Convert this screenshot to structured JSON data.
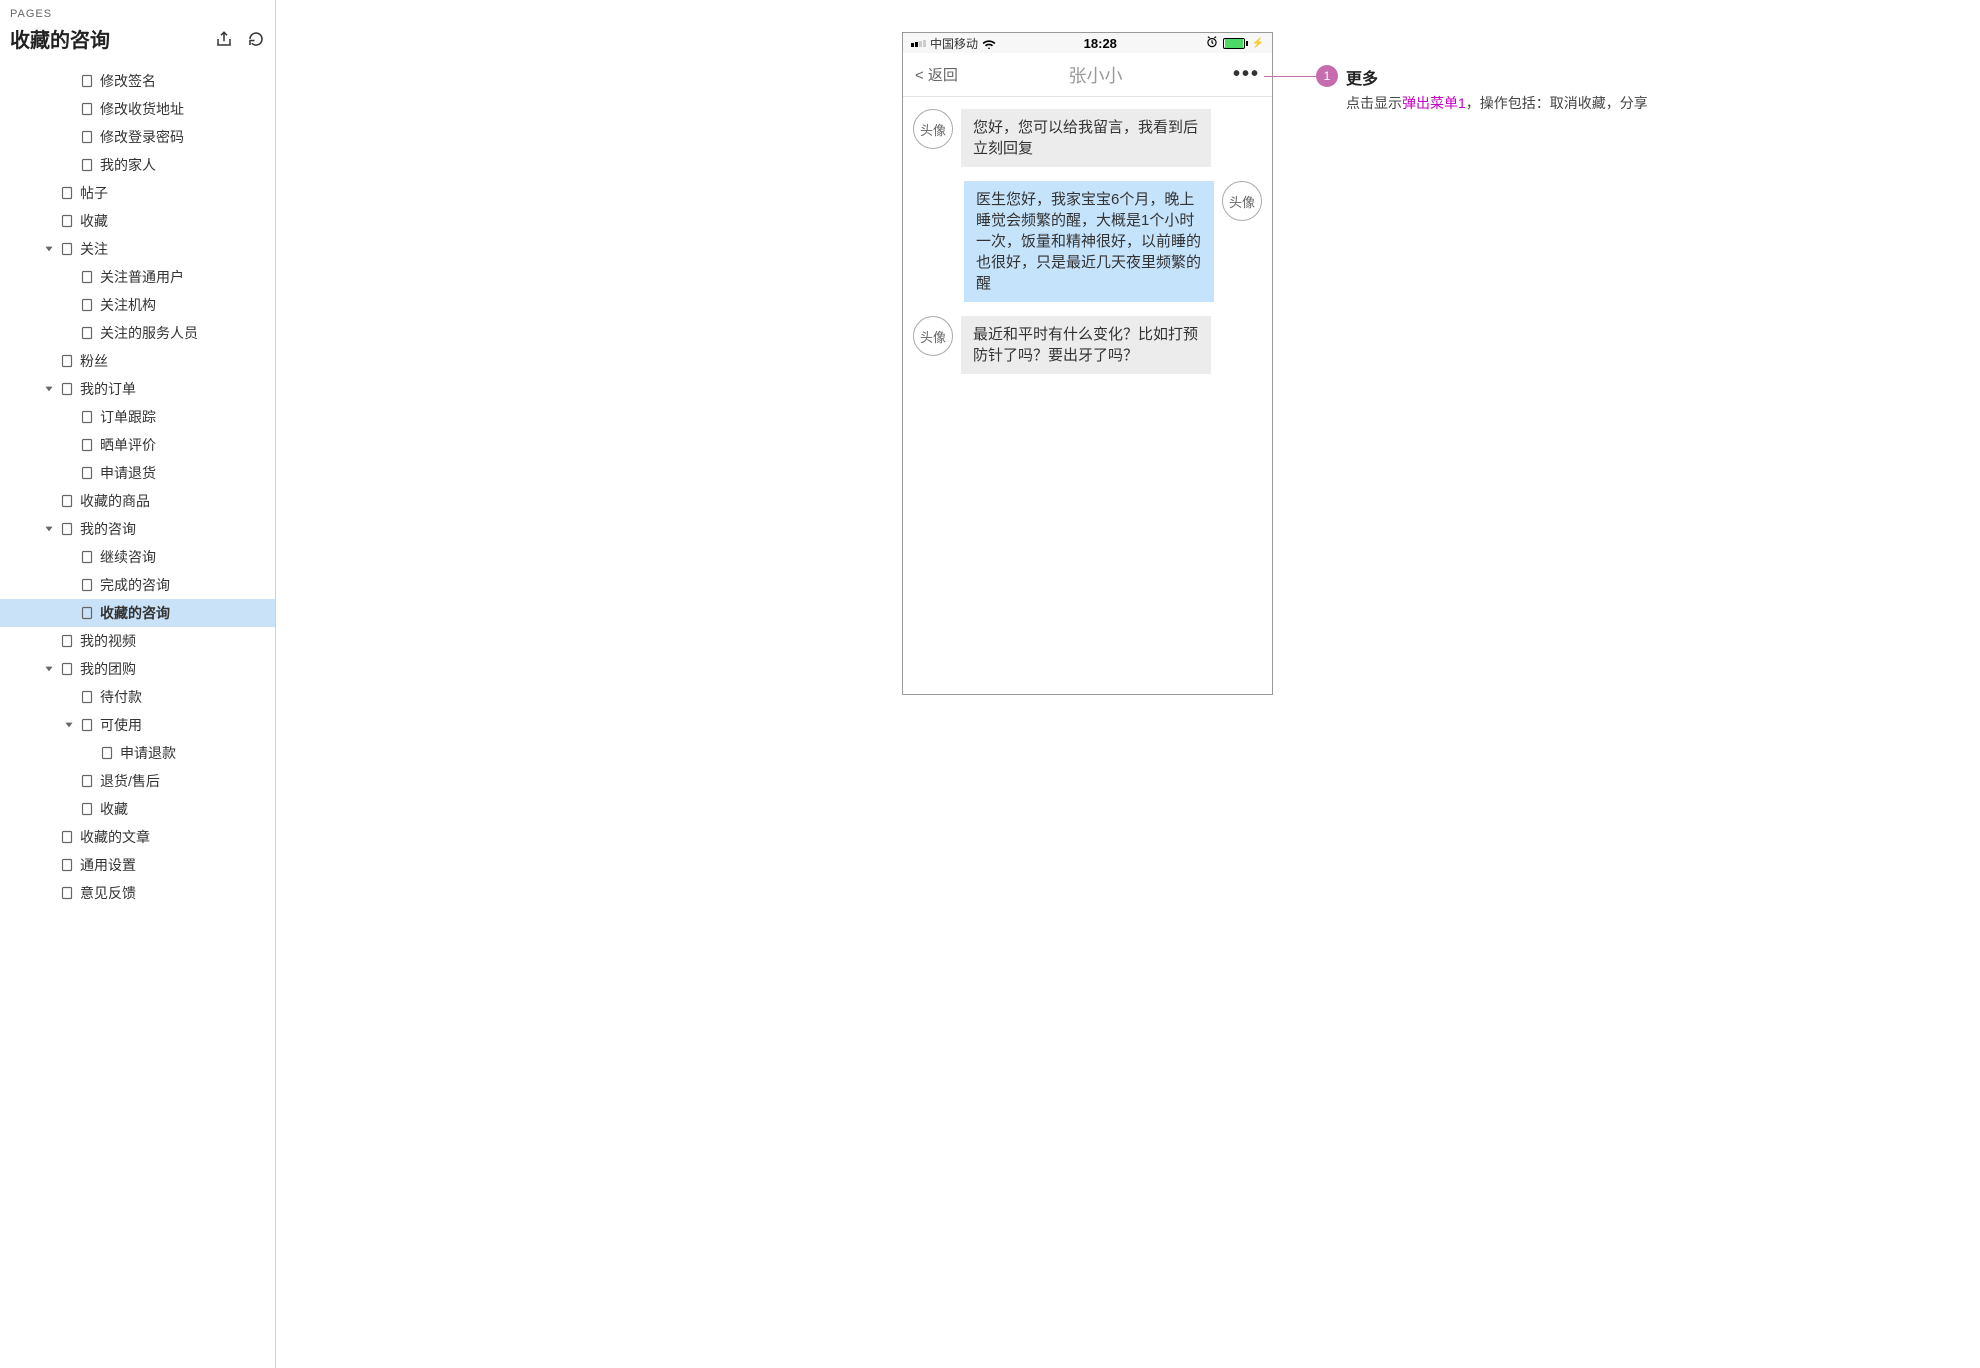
{
  "sidebar": {
    "section_label": "PAGES",
    "title": "收藏的咨询",
    "tree": [
      {
        "label": "修改签名",
        "depth": 3
      },
      {
        "label": "修改收货地址",
        "depth": 3
      },
      {
        "label": "修改登录密码",
        "depth": 3
      },
      {
        "label": "我的家人",
        "depth": 3
      },
      {
        "label": "帖子",
        "depth": 2
      },
      {
        "label": "收藏",
        "depth": 2
      },
      {
        "label": "关注",
        "depth": 2,
        "expandable": true,
        "expanded": true
      },
      {
        "label": "关注普通用户",
        "depth": 3
      },
      {
        "label": "关注机构",
        "depth": 3
      },
      {
        "label": "关注的服务人员",
        "depth": 3
      },
      {
        "label": "粉丝",
        "depth": 2
      },
      {
        "label": "我的订单",
        "depth": 2,
        "expandable": true,
        "expanded": true
      },
      {
        "label": "订单跟踪",
        "depth": 3
      },
      {
        "label": "晒单评价",
        "depth": 3
      },
      {
        "label": "申请退货",
        "depth": 3
      },
      {
        "label": "收藏的商品",
        "depth": 2
      },
      {
        "label": "我的咨询",
        "depth": 2,
        "expandable": true,
        "expanded": true
      },
      {
        "label": "继续咨询",
        "depth": 3
      },
      {
        "label": "完成的咨询",
        "depth": 3
      },
      {
        "label": "收藏的咨询",
        "depth": 3,
        "selected": true
      },
      {
        "label": "我的视频",
        "depth": 2
      },
      {
        "label": "我的团购",
        "depth": 2,
        "expandable": true,
        "expanded": true
      },
      {
        "label": "待付款",
        "depth": 3
      },
      {
        "label": "可使用",
        "depth": 3,
        "expandable": true,
        "expanded": true
      },
      {
        "label": "申请退款",
        "depth": 4
      },
      {
        "label": "退货/售后",
        "depth": 3
      },
      {
        "label": "收藏",
        "depth": 3
      },
      {
        "label": "收藏的文章",
        "depth": 2
      },
      {
        "label": "通用设置",
        "depth": 2
      },
      {
        "label": "意见反馈",
        "depth": 2
      }
    ]
  },
  "device": {
    "status": {
      "carrier": "中国移动",
      "time": "18:28"
    },
    "nav": {
      "back": "< 返回",
      "title": "张小小",
      "more": "•••"
    },
    "avatar_placeholder": "头像",
    "messages": [
      {
        "side": "other",
        "text": "您好，您可以给我留言，我看到后立刻回复"
      },
      {
        "side": "me",
        "text": "医生您好，我家宝宝6个月，晚上睡觉会频繁的醒，大概是1个小时一次，饭量和精神很好，以前睡的也很好，只是最近几天夜里频繁的醒"
      },
      {
        "side": "other",
        "text": "最近和平时有什么变化？比如打预防针了吗？要出牙了吗？"
      }
    ]
  },
  "annotation": {
    "number": "1",
    "title": "更多",
    "desc_before": "点击显示",
    "link": "弹出菜单1",
    "desc_after": "，操作包括：取消收藏，分享"
  }
}
